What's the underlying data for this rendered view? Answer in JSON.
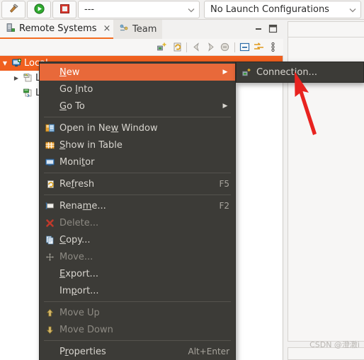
{
  "toolbar": {
    "build_icon": "hammer-icon",
    "run_icon": "run-icon",
    "stop_icon": "stop-icon",
    "target_combo_value": "---",
    "launch_combo_value": "No Launch Configurations"
  },
  "view_tabs": {
    "active": {
      "label": "Remote Systems",
      "icon": "remote-systems-icon",
      "close": "×"
    },
    "inactive": {
      "label": "Team",
      "icon": "team-icon"
    },
    "minimize_title": "Minimize",
    "maximize_title": "Maximize"
  },
  "view_toolbar": {
    "items": [
      {
        "name": "new-connection-icon"
      },
      {
        "name": "refresh-icon"
      },
      {
        "name": "back-arrow-icon"
      },
      {
        "name": "forward-arrow-icon"
      },
      {
        "name": "home-icon"
      },
      {
        "name": "collapse-all-icon"
      },
      {
        "name": "link-with-editor-icon"
      },
      {
        "name": "view-menu-icon"
      }
    ]
  },
  "tree": {
    "items": [
      {
        "label": "Local",
        "icon": "local-host-icon",
        "twist": "▼",
        "selected": true,
        "indent": 0
      },
      {
        "label": "Lo",
        "icon": "local-files-icon",
        "twist": "▶",
        "selected": false,
        "indent": 1
      },
      {
        "label": "Lo",
        "icon": "local-shells-icon",
        "twist": "",
        "selected": false,
        "indent": 1
      }
    ]
  },
  "context_menu": {
    "items": [
      {
        "label": "New",
        "mnemonic": "N",
        "icon": "",
        "accel": "",
        "submenu": true,
        "disabled": false,
        "highlight": true,
        "separator_after": false
      },
      {
        "label": "Go Into",
        "mnemonic": "I",
        "icon": "",
        "accel": "",
        "submenu": false,
        "disabled": false,
        "highlight": false,
        "separator_after": false
      },
      {
        "label": "Go To",
        "mnemonic": "G",
        "icon": "",
        "accel": "",
        "submenu": true,
        "disabled": false,
        "highlight": false,
        "separator_after": true
      },
      {
        "label": "Open in New Window",
        "mnemonic": "W",
        "icon": "open-new-window-icon",
        "accel": "",
        "submenu": false,
        "disabled": false,
        "highlight": false,
        "separator_after": false
      },
      {
        "label": "Show in Table",
        "mnemonic": "S",
        "icon": "show-in-table-icon",
        "accel": "",
        "submenu": false,
        "disabled": false,
        "highlight": false,
        "separator_after": false
      },
      {
        "label": "Monitor",
        "mnemonic": "t",
        "icon": "monitor-icon",
        "accel": "",
        "submenu": false,
        "disabled": false,
        "highlight": false,
        "separator_after": true
      },
      {
        "label": "Refresh",
        "mnemonic": "f",
        "icon": "refresh-icon",
        "accel": "F5",
        "submenu": false,
        "disabled": false,
        "highlight": false,
        "separator_after": true
      },
      {
        "label": "Rename...",
        "mnemonic": "m",
        "icon": "rename-icon",
        "accel": "F2",
        "submenu": false,
        "disabled": false,
        "highlight": false,
        "separator_after": false
      },
      {
        "label": "Delete...",
        "mnemonic": "",
        "icon": "delete-icon",
        "accel": "",
        "submenu": false,
        "disabled": true,
        "highlight": false,
        "separator_after": false
      },
      {
        "label": "Copy...",
        "mnemonic": "C",
        "icon": "copy-icon",
        "accel": "",
        "submenu": false,
        "disabled": false,
        "highlight": false,
        "separator_after": false
      },
      {
        "label": "Move...",
        "mnemonic": "",
        "icon": "move-icon",
        "accel": "",
        "submenu": false,
        "disabled": true,
        "highlight": false,
        "separator_after": false
      },
      {
        "label": "Export...",
        "mnemonic": "E",
        "icon": "",
        "accel": "",
        "submenu": false,
        "disabled": false,
        "highlight": false,
        "separator_after": false
      },
      {
        "label": "Import...",
        "mnemonic": "p",
        "icon": "",
        "accel": "",
        "submenu": false,
        "disabled": false,
        "highlight": false,
        "separator_after": true
      },
      {
        "label": "Move Up",
        "mnemonic": "",
        "icon": "move-up-icon",
        "accel": "",
        "submenu": false,
        "disabled": true,
        "highlight": false,
        "separator_after": false
      },
      {
        "label": "Move Down",
        "mnemonic": "",
        "icon": "move-down-icon",
        "accel": "",
        "submenu": false,
        "disabled": true,
        "highlight": false,
        "separator_after": true
      },
      {
        "label": "Properties",
        "mnemonic": "r",
        "icon": "",
        "accel": "Alt+Enter",
        "submenu": false,
        "disabled": false,
        "highlight": false,
        "separator_after": false
      }
    ]
  },
  "submenu": {
    "items": [
      {
        "label": "Connection...",
        "icon": "new-connection-icon"
      }
    ]
  },
  "annotation": {
    "arrow_color": "#e8231f"
  },
  "watermark": {
    "text": "CSDN @澄澈i"
  },
  "colors": {
    "selection_orange": "#f0601f",
    "menu_highlight": "#e8693a",
    "menu_bg": "#3c3b37",
    "accent": "#f36c21"
  }
}
